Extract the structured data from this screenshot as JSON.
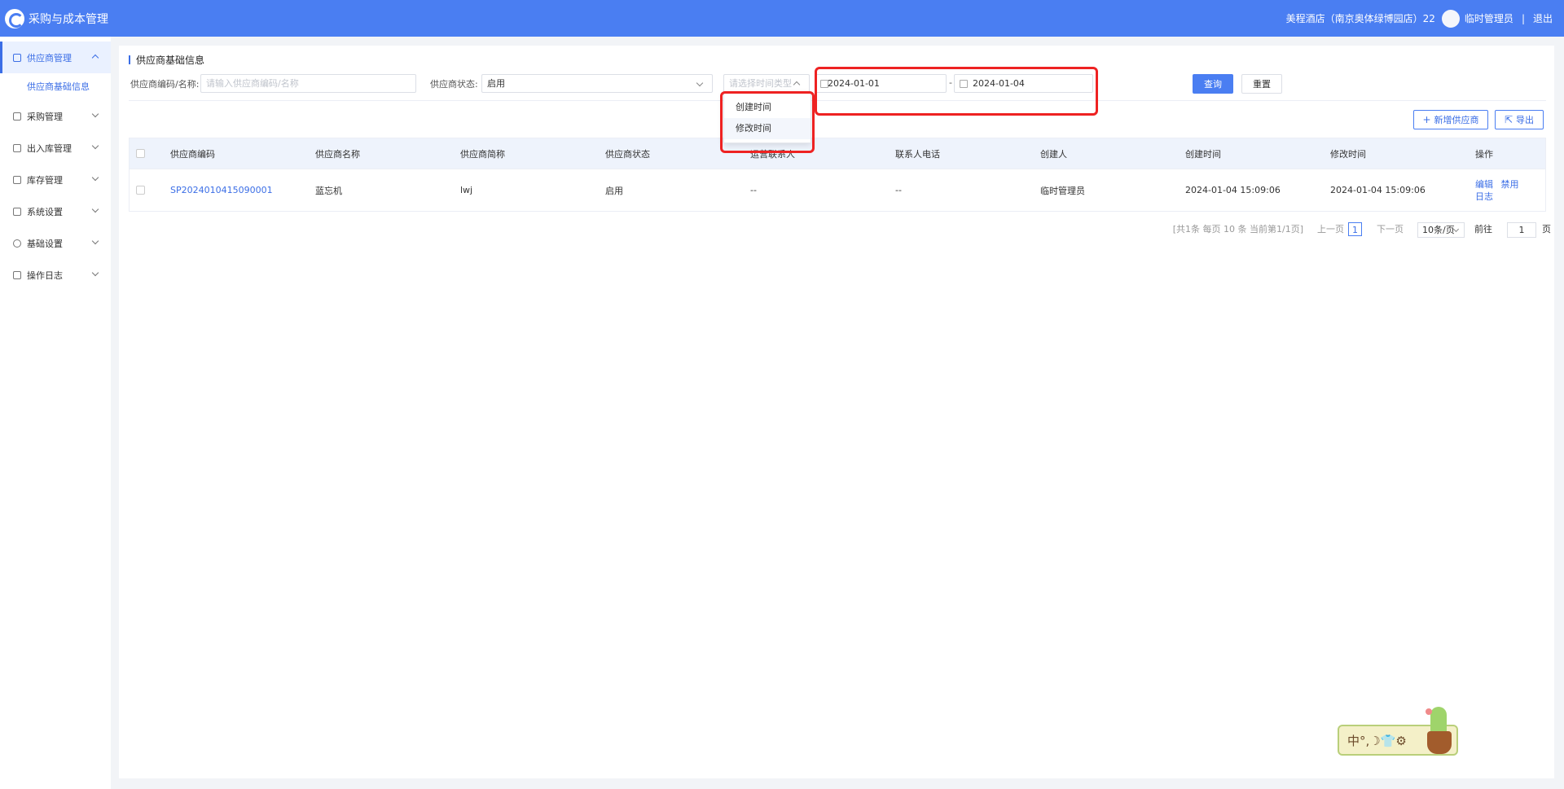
{
  "app": {
    "title": "采购与成本管理"
  },
  "header": {
    "store": "美程酒店（南京奥体绿博园店）22",
    "user": "临时管理员",
    "separator": "|",
    "logout": "退出"
  },
  "sidebar": {
    "items": [
      {
        "label": "供应商管理",
        "icon": "supplier-icon",
        "expanded": true,
        "sub": [
          "供应商基础信息"
        ]
      },
      {
        "label": "采购管理",
        "icon": "purchase-icon"
      },
      {
        "label": "出入库管理",
        "icon": "stock-io-icon"
      },
      {
        "label": "库存管理",
        "icon": "inventory-icon"
      },
      {
        "label": "系统设置",
        "icon": "system-icon"
      },
      {
        "label": "基础设置",
        "icon": "settings-icon"
      },
      {
        "label": "操作日志",
        "icon": "log-icon"
      }
    ]
  },
  "page": {
    "title": "供应商基础信息"
  },
  "filters": {
    "code_label": "供应商编码/名称:",
    "code_placeholder": "请输入供应商编码/名称",
    "status_label": "供应商状态:",
    "status_value": "启用",
    "time_type_placeholder": "请选择时间类型",
    "date_start": "2024-01-01",
    "date_sep": "-",
    "date_end": "2024-01-04",
    "query_button": "查询",
    "reset_button": "重置"
  },
  "actions": {
    "add_button": "新增供应商",
    "export_button": "导出"
  },
  "dropdown": {
    "options": [
      "创建时间",
      "修改时间"
    ]
  },
  "table": {
    "columns": [
      "供应商编码",
      "供应商名称",
      "供应商简称",
      "供应商状态",
      "运营联系人",
      "联系人电话",
      "创建人",
      "创建时间",
      "修改时间",
      "操作"
    ],
    "rows": [
      {
        "code": "SP2024010415090001",
        "name": "蓝忘机",
        "short": "lwj",
        "status": "启用",
        "contact": "--",
        "phone": "--",
        "creator": "临时管理员",
        "created": "2024-01-04 15:09:06",
        "modified": "2024-01-04 15:09:06",
        "op_edit": "编辑",
        "op_disable": "禁用",
        "op_log": "日志"
      }
    ]
  },
  "pagination": {
    "summary": "[共1条 每页 10 条 当前第1/1页]",
    "prev": "上一页",
    "current": "1",
    "next": "下一页",
    "page_size": "10条/页",
    "goto_label": "前往",
    "goto_value": "1",
    "page_suffix": "页"
  },
  "ime": {
    "text": "中°,☽👕⚙"
  },
  "colors": {
    "primary": "#4a7ef2",
    "highlight": "#ee2222"
  }
}
